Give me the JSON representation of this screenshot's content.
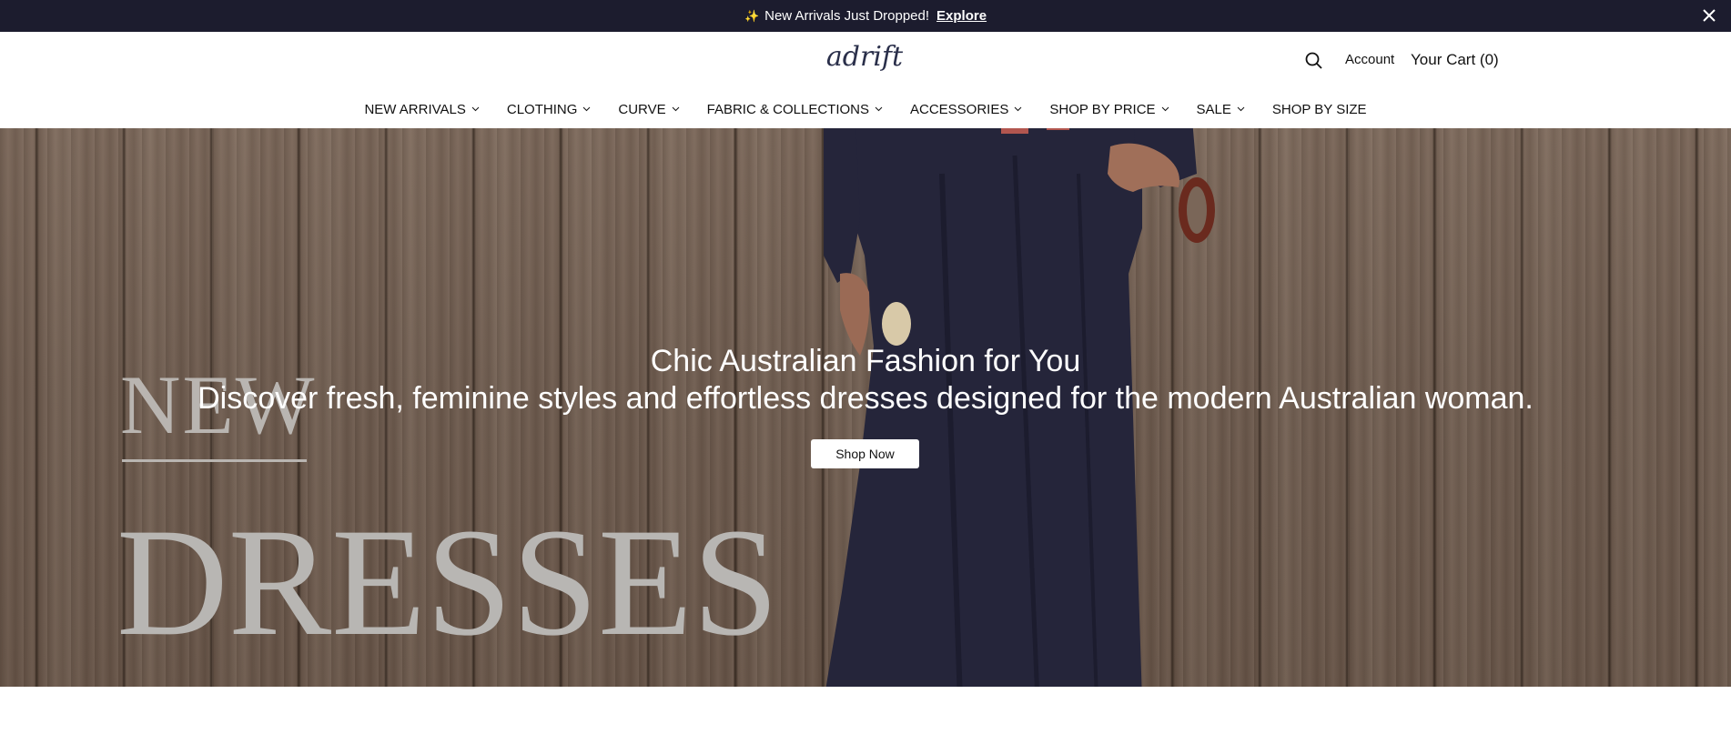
{
  "announcement": {
    "sparkle_icon": "✨",
    "text": "New Arrivals Just Dropped!",
    "link": "Explore"
  },
  "header": {
    "logo": "adrift",
    "account": "Account",
    "cart": "Your Cart (0)"
  },
  "nav": {
    "items": [
      {
        "label": "NEW ARRIVALS",
        "has_dropdown": true
      },
      {
        "label": "CLOTHING",
        "has_dropdown": true
      },
      {
        "label": "CURVE",
        "has_dropdown": true
      },
      {
        "label": "FABRIC & COLLECTIONS",
        "has_dropdown": true
      },
      {
        "label": "ACCESSORIES",
        "has_dropdown": true
      },
      {
        "label": "SHOP BY PRICE",
        "has_dropdown": true
      },
      {
        "label": "SALE",
        "has_dropdown": true
      },
      {
        "label": "SHOP BY SIZE",
        "has_dropdown": false
      }
    ]
  },
  "hero": {
    "headline": "Chic Australian Fashion for You",
    "subline": "Discover fresh, feminine styles and effortless dresses designed for the modern Australian woman.",
    "cta": "Shop Now",
    "overlay_word_1": "NEW",
    "overlay_word_2": "DRESSES"
  },
  "colors": {
    "announcement_bg": "#1c1c2e",
    "logo": "#2a2f4a",
    "hero_wood": "#6e5b4e",
    "dress": "#25253a"
  }
}
